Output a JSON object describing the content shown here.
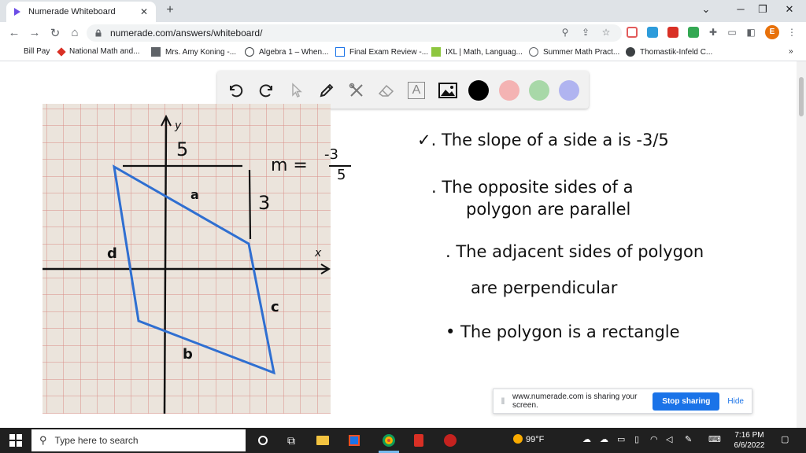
{
  "browser": {
    "tab_title": "Numerade Whiteboard",
    "tab_close": "✕",
    "new_tab": "+",
    "url": "numerade.com/answers/whiteboard/",
    "profile_initial": "E",
    "window_controls": {
      "minimize": "─",
      "restore": "❐",
      "close": "✕",
      "dropdown": "⌄"
    }
  },
  "bookmarks": [
    {
      "label": "Bill Pay",
      "icon": "bill-icon"
    },
    {
      "label": "National Math and...",
      "icon": "nm-icon"
    },
    {
      "label": "Mrs. Amy Koning -...",
      "icon": "doc-icon"
    },
    {
      "label": "Algebra 1 – When...",
      "icon": "wordpress-icon"
    },
    {
      "label": "Final Exam Review -...",
      "icon": "calendar-icon"
    },
    {
      "label": "IXL | Math, Languag...",
      "icon": "ixl-icon"
    },
    {
      "label": "Summer Math Pract...",
      "icon": "summer-icon"
    },
    {
      "label": "Thomastik-Infeld C...",
      "icon": "globe-icon"
    }
  ],
  "bookmarks_more": "»",
  "whiteboard": {
    "tools": [
      "undo-icon",
      "redo-icon",
      "select-icon",
      "pen-icon",
      "tools-icon",
      "eraser-icon",
      "text-icon",
      "image-icon"
    ],
    "text_tool_label": "A",
    "colors": [
      "#000000",
      "#f4b3b3",
      "#a8d8a8",
      "#b0b4f0"
    ]
  },
  "graph": {
    "y_label": "y",
    "x_label": "x",
    "rise": "5",
    "run": "3",
    "side_a": "a",
    "side_b": "b",
    "side_c": "c",
    "side_d": "d",
    "slope_m": "m =",
    "slope_num": "-3",
    "slope_den": "5"
  },
  "notes": [
    "✓. The slope of a side a is -3/5",
    ". The opposite sides of a",
    "polygon are parallel",
    ". The adjacent sides of polygon",
    "are perpendicular",
    "• The polygon is a rectangle"
  ],
  "share_bar": {
    "message": "www.numerade.com is sharing your screen.",
    "stop_label": "Stop sharing",
    "hide_label": "Hide"
  },
  "taskbar": {
    "search_placeholder": "Type here to search",
    "weather": "99°F",
    "time": "7:16 PM",
    "date": "6/6/2022"
  }
}
